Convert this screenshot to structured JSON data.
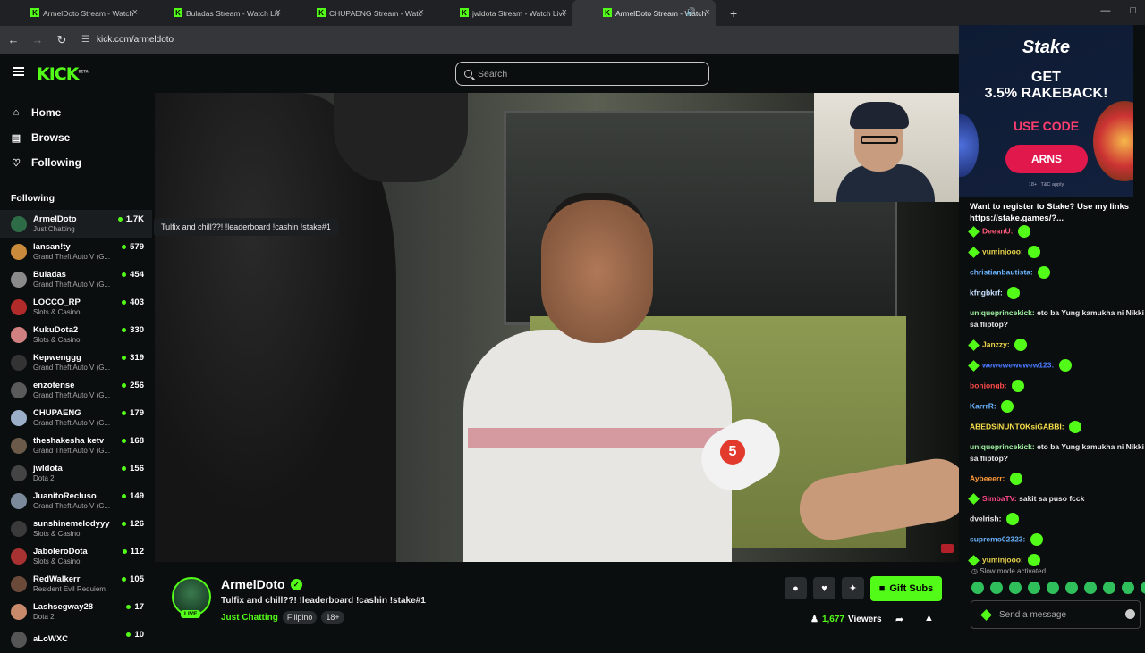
{
  "browser": {
    "tabs": [
      {
        "title": "ArmelDoto Stream - Watch Live",
        "active": false
      },
      {
        "title": "Buladas Stream - Watch Live on",
        "active": false
      },
      {
        "title": "CHUPAENG Stream - Watch Live",
        "active": false
      },
      {
        "title": "jwldota Stream - Watch Live on",
        "active": false
      },
      {
        "title": "ArmelDoto Stream - Watch",
        "active": true
      }
    ],
    "url": "kick.com/armeldoto"
  },
  "header": {
    "logo": "KICK",
    "logo_sup": "BETA",
    "search_placeholder": "Search"
  },
  "sidebar": {
    "nav": [
      {
        "label": "Home",
        "icon": "home-icon"
      },
      {
        "label": "Browse",
        "icon": "browse-icon"
      },
      {
        "label": "Following",
        "icon": "heart-icon"
      }
    ],
    "following_title": "Following",
    "channels": [
      {
        "name": "ArmelDoto",
        "game": "Just Chatting",
        "viewers": "1.7K",
        "color": "#2e6b47"
      },
      {
        "name": "lansan!ty",
        "game": "Grand Theft Auto V (G...",
        "viewers": "579",
        "color": "#c98a3b"
      },
      {
        "name": "Buladas",
        "game": "Grand Theft Auto V (G...",
        "viewers": "454",
        "color": "#8a8a8a"
      },
      {
        "name": "LOCCO_RP",
        "game": "Slots & Casino",
        "viewers": "403",
        "color": "#b22b2b"
      },
      {
        "name": "KukuDota2",
        "game": "Slots & Casino",
        "viewers": "330",
        "color": "#d08080"
      },
      {
        "name": "Kepwenggg",
        "game": "Grand Theft Auto V (G...",
        "viewers": "319",
        "color": "#333333"
      },
      {
        "name": "enzotense",
        "game": "Grand Theft Auto V (G...",
        "viewers": "256",
        "color": "#5a5a5a"
      },
      {
        "name": "CHUPAENG",
        "game": "Grand Theft Auto V (G...",
        "viewers": "179",
        "color": "#9bb0c8"
      },
      {
        "name": "theshakesha ketv",
        "game": "Grand Theft Auto V (G...",
        "viewers": "168",
        "color": "#6b5a4a"
      },
      {
        "name": "jwldota",
        "game": "Dota 2",
        "viewers": "156",
        "color": "#444444"
      },
      {
        "name": "JuanitoRecluso",
        "game": "Grand Theft Auto V (G...",
        "viewers": "149",
        "color": "#7a8a9a"
      },
      {
        "name": "sunshinemelodyyy",
        "game": "Slots & Casino",
        "viewers": "126",
        "color": "#3a3a3a"
      },
      {
        "name": "JaboleroDota",
        "game": "Slots & Casino",
        "viewers": "112",
        "color": "#a83232"
      },
      {
        "name": "RedWalkerr",
        "game": "Resident Evil Requiem",
        "viewers": "105",
        "color": "#6b4a3a"
      },
      {
        "name": "Lashsegway28",
        "game": "Dota 2",
        "viewers": "17",
        "color": "#c88a6a"
      },
      {
        "name": "aLoWXC",
        "game": "",
        "viewers": "10",
        "color": "#555555"
      }
    ]
  },
  "tooltip": "Tulfix and chill??! !leaderboard !cashin !stake#1",
  "stream": {
    "name": "ArmelDoto",
    "live_label": "LIVE",
    "title": "Tulfix and chill??! !leaderboard !cashin !stake#1",
    "category": "Just Chatting",
    "tags": [
      "Filipino",
      "18+"
    ],
    "gift_label": "Gift Subs",
    "viewers_count": "1,677",
    "viewers_label": "Viewers",
    "mic_channel": "5"
  },
  "chat": {
    "ad": {
      "brand": "Stake",
      "line1": "GET",
      "line2": "3.5% RAKEBACK!",
      "use_code": "USE CODE",
      "code": "ARNS",
      "terms": "18+ | T&C apply"
    },
    "pinned_text": "Want to register to Stake? Use my links",
    "pinned_link": "https://stake.games/?...",
    "messages": [
      {
        "user": "DeeanU:",
        "color": "#ff5a7a",
        "text": "",
        "badge": true,
        "emote": true
      },
      {
        "user": "yuminjooo:",
        "color": "#e9d44a",
        "text": "",
        "badge": true,
        "emote": true
      },
      {
        "user": "christianbautista:",
        "color": "#6ab4ff",
        "text": "",
        "badge": false,
        "emote": true
      },
      {
        "user": "kfngbkrf:",
        "color": "#c7e0ff",
        "text": "",
        "badge": false,
        "emote": true
      },
      {
        "user": "uniqueprincekick:",
        "color": "#9ff0a0",
        "text": "eto ba Yung kamukha ni Nikki sa fliptop?",
        "badge": false,
        "emote": false
      },
      {
        "user": "Janzzy:",
        "color": "#e9d44a",
        "text": "",
        "badge": true,
        "emote": true
      },
      {
        "user": "wewewewewew123:",
        "color": "#4a7aff",
        "text": "",
        "badge": true,
        "emote": true
      },
      {
        "user": "bonjongb:",
        "color": "#ff4a4a",
        "text": "",
        "badge": false,
        "emote": true
      },
      {
        "user": "KarrrR:",
        "color": "#6ab4ff",
        "text": "",
        "badge": false,
        "emote": true
      },
      {
        "user": "ABEDSINUNTOKsiGABBI:",
        "color": "#f7e04a",
        "text": "",
        "badge": false,
        "emote": true
      },
      {
        "user": "uniqueprincekick:",
        "color": "#9ff0a0",
        "text": "eto ba Yung kamukha ni Nikki sa fliptop?",
        "badge": false,
        "emote": false
      },
      {
        "user": "Aybeeerr:",
        "color": "#ff9a3a",
        "text": "",
        "badge": false,
        "emote": true
      },
      {
        "user": "SimbaTV:",
        "color": "#ff4a8a",
        "text": "sakit sa puso fcck",
        "badge": true,
        "emote": false
      },
      {
        "user": "dvelrish:",
        "color": "#e8e8e8",
        "text": "",
        "badge": false,
        "emote": true
      },
      {
        "user": "supremo02323:",
        "color": "#6ab4ff",
        "text": "",
        "badge": false,
        "emote": true
      },
      {
        "user": "yuminjooo:",
        "color": "#e9d44a",
        "text": "",
        "badge": true,
        "emote": true
      }
    ],
    "slow_mode": "Slow mode activated",
    "send_placeholder": "Send a message"
  }
}
